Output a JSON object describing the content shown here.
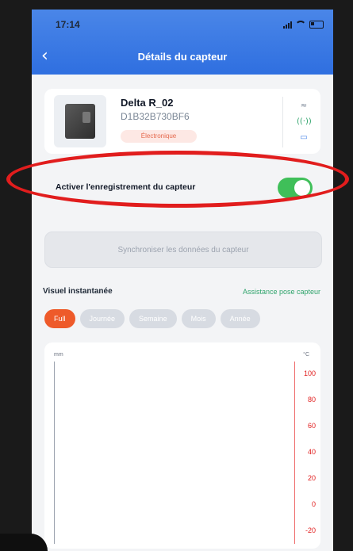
{
  "status": {
    "time": "17:14"
  },
  "header": {
    "title": "Détails du capteur"
  },
  "sensor": {
    "name": "Delta R_02",
    "id": "D1B32B730BF6",
    "badge": "Électronique"
  },
  "toggle": {
    "label": "Activer l'enregistrement du capteur",
    "state": "on"
  },
  "sync_button": {
    "label": "Synchroniser les données du capteur"
  },
  "section": {
    "title": "Visuel instantanée",
    "assist_link": "Assistance pose capteur"
  },
  "chips": [
    {
      "label": "Full",
      "active": true
    },
    {
      "label": "Journée",
      "active": false
    },
    {
      "label": "Semaine",
      "active": false
    },
    {
      "label": "Mois",
      "active": false
    },
    {
      "label": "Année",
      "active": false
    }
  ],
  "chart": {
    "unit_left": "mm",
    "unit_right": "°C",
    "right_ticks": [
      "100",
      "80",
      "60",
      "40",
      "20",
      "0",
      "-20"
    ]
  },
  "colors": {
    "header_blue": "#2f6fe0",
    "toggle_green": "#3fbf59",
    "chip_active": "#ee5a2a",
    "badge_text": "#e56a4e",
    "assist_green": "#30a46c",
    "annotation_red": "#e11d1d"
  },
  "icons": [
    "back-icon",
    "wifi-icon",
    "signal-icon",
    "battery-icon",
    "bluetooth-wave-icon",
    "battery-small-icon"
  ]
}
